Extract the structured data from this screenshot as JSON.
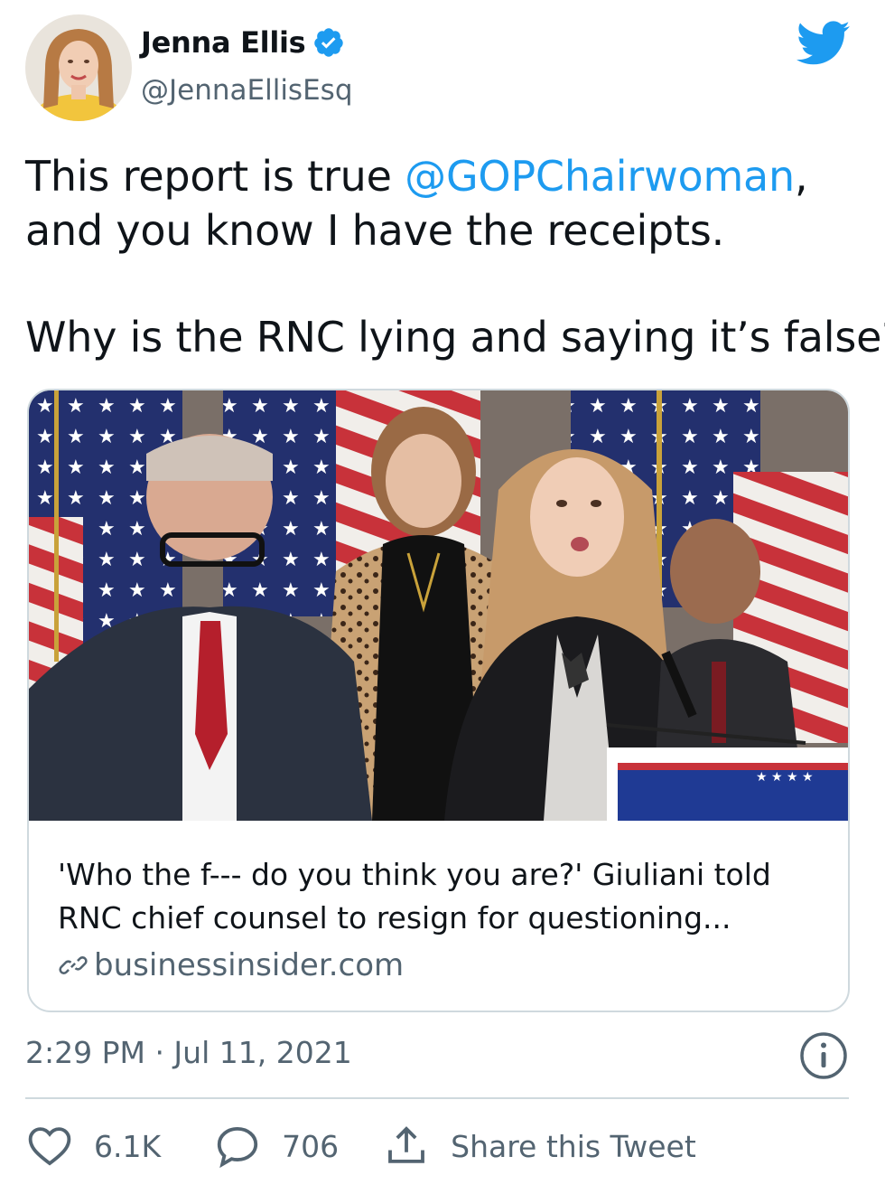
{
  "author": {
    "name": "Jenna Ellis",
    "handle": "@JennaEllisEsq"
  },
  "tweet": {
    "text_line1_prefix": "This report is true ",
    "mention": "@GOPChairwoman",
    "text_line1_suffix": ",",
    "text_line2": "and you know I have the receipts.",
    "text_line3": "Why is the RNC lying and saying it’s false?"
  },
  "card": {
    "title_line1": "'Who the f--- do you think you are?' Giuliani told",
    "title_line2": "RNC chief counsel to resign for questioning...",
    "domain": "businessinsider.com"
  },
  "meta": {
    "timestamp": "2:29 PM · Jul 11, 2021"
  },
  "actions": {
    "likes": "6.1K",
    "replies": "706",
    "share_label": "Share this Tweet"
  },
  "colors": {
    "accent": "#1d9bf0",
    "secondary_text": "#536471",
    "border": "#cfd9de"
  },
  "icons": [
    "verified-badge-icon",
    "twitter-bird-icon",
    "link-icon",
    "info-icon",
    "heart-icon",
    "reply-icon",
    "share-icon"
  ]
}
